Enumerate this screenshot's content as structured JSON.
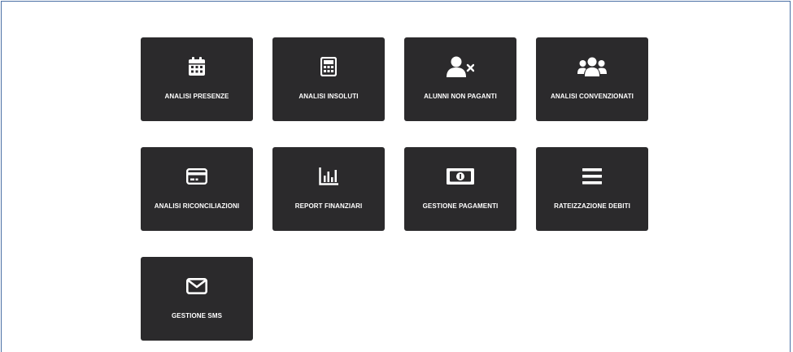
{
  "tiles": [
    {
      "label": "ANALISI PRESENZE",
      "icon": "calendar-icon"
    },
    {
      "label": "ANALISI INSOLUTI",
      "icon": "calculator-icon"
    },
    {
      "label": "ALUNNI NON PAGANTI",
      "icon": "user-remove-icon"
    },
    {
      "label": "ANALISI CONVENZIONATI",
      "icon": "users-group-icon"
    },
    {
      "label": "ANALISI RICONCILIAZIONI",
      "icon": "credit-card-icon"
    },
    {
      "label": "REPORT FINANZIARI",
      "icon": "bar-chart-icon"
    },
    {
      "label": "GESTIONE PAGAMENTI",
      "icon": "money-bill-icon"
    },
    {
      "label": "RATEIZZAZIONE DEBITI",
      "icon": "list-bars-icon"
    },
    {
      "label": "GESTIONE SMS",
      "icon": "envelope-icon"
    }
  ],
  "colors": {
    "tile_bg": "#2b2a2c",
    "tile_fg": "#ffffff",
    "border": "#4a6fa5"
  }
}
